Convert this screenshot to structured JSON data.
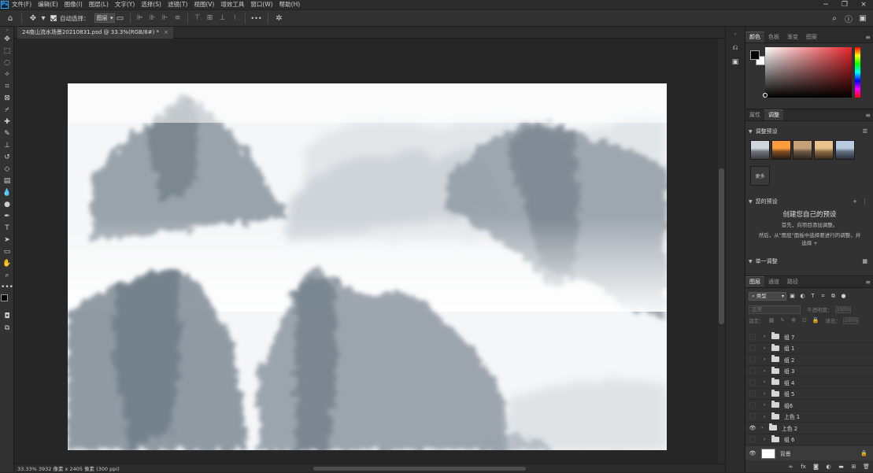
{
  "app": {
    "logo": "Ps"
  },
  "menu": [
    "文件(F)",
    "编辑(E)",
    "图像(I)",
    "图层(L)",
    "文字(Y)",
    "选择(S)",
    "滤镜(T)",
    "视图(V)",
    "增效工具",
    "窗口(W)",
    "帮助(H)"
  ],
  "options_bar": {
    "auto_select_label": "自动选择：",
    "auto_select_value": "图层",
    "auto_select_checked": true,
    "more_label": "•••"
  },
  "document": {
    "tab_title": "24南山流水场景20210831.psd @ 33.3%(RGB/8#) *",
    "close_glyph": "×",
    "status": "33.33%   3932 像素 x 2405 像素 (300 ppi)"
  },
  "panels": {
    "color_tabs": [
      "颜色",
      "色板",
      "渐变",
      "图案"
    ],
    "adjust_tabs": [
      "属性",
      "调整"
    ],
    "layers_tabs": [
      "图层",
      "通道",
      "路径"
    ],
    "adjust_presets_title": "调整预设",
    "more_label": "更多",
    "your_presets_title": "您的预设",
    "create_title": "创建您自己的预设",
    "create_line1": "首先，向项目添加调整。",
    "create_line2": "然后，从\"图层\"面板中选择要进行的调整，并",
    "create_line3": "选择 +",
    "single_adjust_title": "单一调整"
  },
  "layers_panel": {
    "kind_label": "类型",
    "blend_mode": "正常",
    "opacity_label": "不透明度：",
    "opacity_value": "100%",
    "lock_label": "锁定：",
    "fill_label": "填充：",
    "fill_value": "100%",
    "layers": [
      {
        "name": "组 7",
        "visible": false
      },
      {
        "name": "组 1",
        "visible": false
      },
      {
        "name": "组 2",
        "visible": false
      },
      {
        "name": "组 3",
        "visible": false
      },
      {
        "name": "组 4",
        "visible": false
      },
      {
        "name": "组 5",
        "visible": false
      },
      {
        "name": "组6",
        "visible": false
      },
      {
        "name": "上色 1",
        "visible": false
      },
      {
        "name": "上色 2",
        "visible": true
      },
      {
        "name": "组 6",
        "visible": false
      }
    ],
    "background_layer": {
      "name": "背景",
      "visible": true
    }
  },
  "colors": {
    "foreground": "#000000",
    "background": "#ffffff",
    "accent": "#31a8ff"
  },
  "icons": {
    "menubar_logo": "photoshop-logo",
    "layer_folder": "folder-icon",
    "visibility": "eye-icon"
  }
}
